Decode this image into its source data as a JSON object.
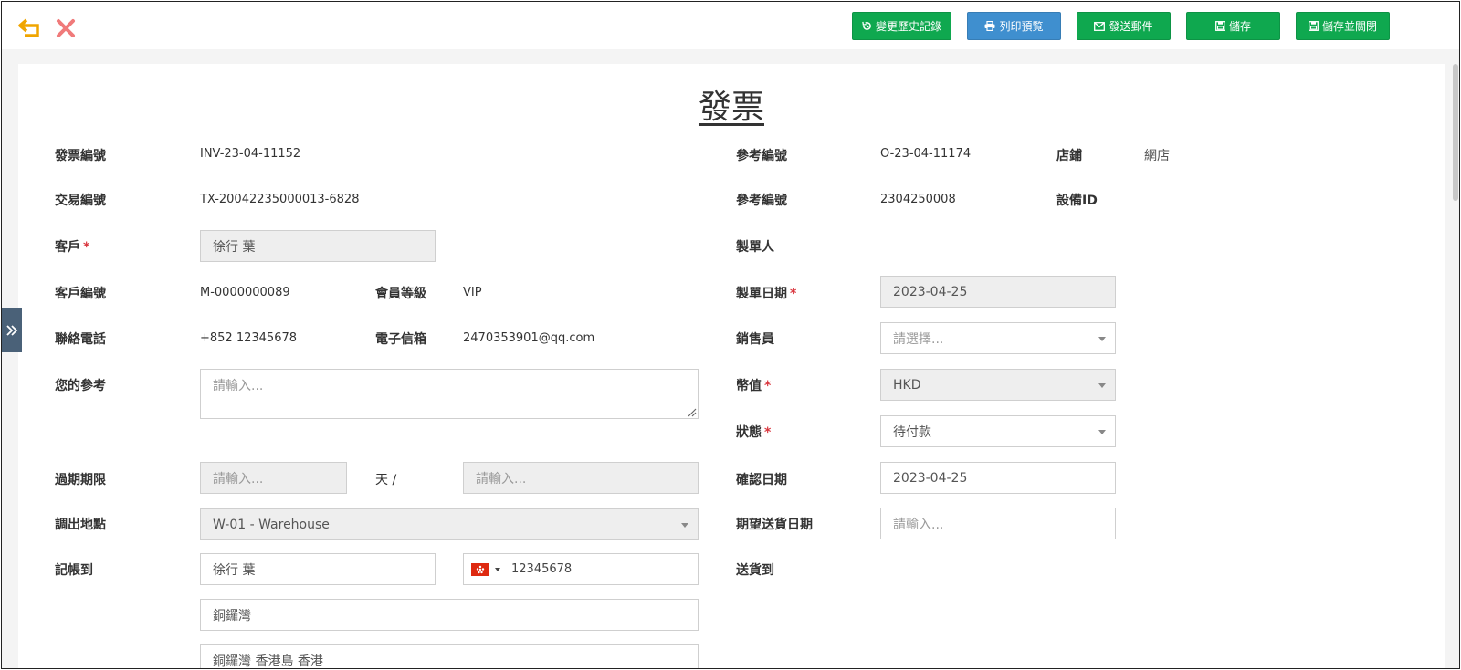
{
  "toolbar": {
    "buttons": {
      "history": "變更歷史記錄",
      "print": "列印預覧",
      "email": "發送郵件",
      "save": "儲存",
      "save_close": "儲存並關閉"
    },
    "colors": {
      "green": "#0fa84f",
      "blue": "#3f8fcf",
      "back_icon": "#f0a500",
      "close_icon": "#f07a7a"
    },
    "icons": [
      "back-arrow-icon",
      "close-icon",
      "history-icon",
      "print-icon",
      "envelope-icon",
      "save-icon"
    ]
  },
  "page": {
    "title": "發票"
  },
  "form": {
    "invoice_no": {
      "label": "發票編號",
      "value": "INV-23-04-11152"
    },
    "transaction_no": {
      "label": "交易編號",
      "value": "TX-20042235000013-6828"
    },
    "customer": {
      "label": "客戶",
      "required": "*",
      "value": "徐行 葉"
    },
    "customer_no": {
      "label": "客戶編號",
      "value": "M-0000000089"
    },
    "member_level": {
      "label": "會員等級",
      "value": "VIP"
    },
    "phone": {
      "label": "聯絡電話",
      "value": "+852 12345678"
    },
    "email": {
      "label": "電子信箱",
      "value": "2470353901@qq.com"
    },
    "your_reference": {
      "label": "您的參考",
      "placeholder": "請輸入..."
    },
    "expiry": {
      "label": "過期期限",
      "placeholder_a": "請輸入...",
      "unit": "天 /",
      "placeholder_b": "請輸入..."
    },
    "dispatch_location": {
      "label": "調出地點",
      "value": "W-01 - Warehouse"
    },
    "bill_to": {
      "label": "記帳到",
      "name": "徐行 葉",
      "phone": "12345678",
      "address1": "銅鑼灣",
      "address2": "銅鑼灣 香港島 香港"
    },
    "reference_no_1": {
      "label": "參考編號",
      "value": "O-23-04-11174"
    },
    "store": {
      "label": "店鋪",
      "value": "網店"
    },
    "reference_no_2": {
      "label": "參考編號",
      "value": "2304250008"
    },
    "device_id": {
      "label": "設備ID",
      "value": ""
    },
    "maker": {
      "label": "製單人",
      "value": ""
    },
    "make_date": {
      "label": "製單日期",
      "required": "*",
      "value": "2023-04-25"
    },
    "salesperson": {
      "label": "銷售員",
      "placeholder": "請選擇..."
    },
    "currency": {
      "label": "幣值",
      "required": "*",
      "value": "HKD"
    },
    "status": {
      "label": "狀態",
      "required": "*",
      "value": "待付款"
    },
    "confirm_date": {
      "label": "確認日期",
      "value": "2023-04-25"
    },
    "expected_delivery": {
      "label": "期望送貨日期",
      "placeholder": "請輸入..."
    },
    "ship_to": {
      "label": "送貨到"
    }
  }
}
